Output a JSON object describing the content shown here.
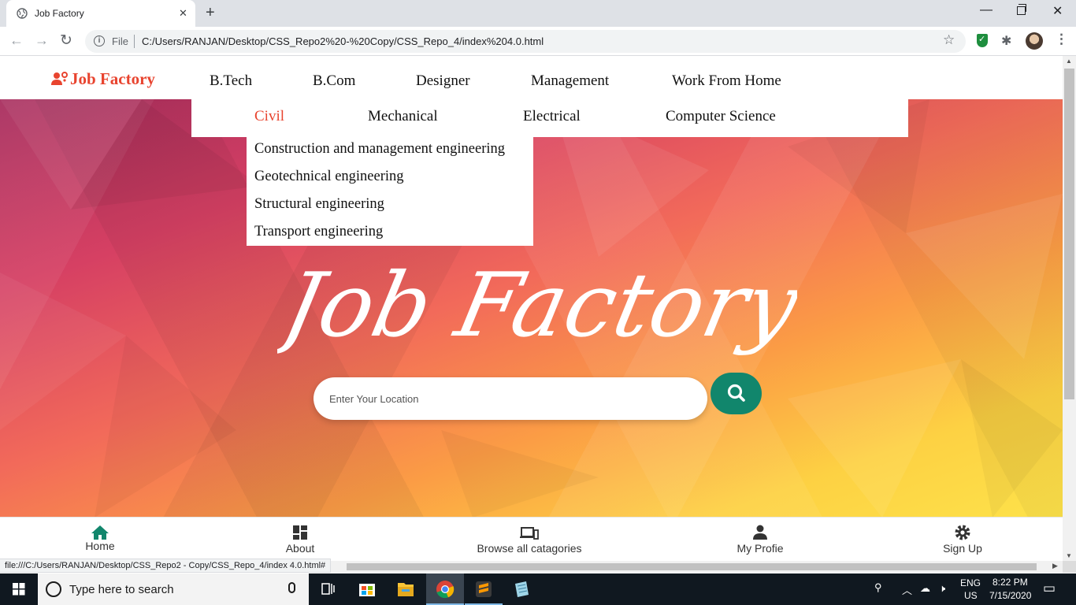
{
  "browser": {
    "tab_title": "Job Factory",
    "new_tab_symbol": "+",
    "scheme": "File",
    "url": "C:/Users/RANJAN/Desktop/CSS_Repo2%20-%20Copy/CSS_Repo_4/index%204.0.html",
    "status_url": "file:///C:/Users/RANJAN/Desktop/CSS_Repo2 - Copy/CSS_Repo_4/index 4.0.html#"
  },
  "site": {
    "logo_text": "Job Factory",
    "accent_color": "#e8442f",
    "nav_items": [
      "B.Tech",
      "B.Com",
      "Designer",
      "Management",
      "Work From Home"
    ],
    "submenu_items": [
      "Civil",
      "Mechanical",
      "Electrical",
      "Computer Science"
    ],
    "active_submenu": "Civil",
    "dropdown_items": [
      "Construction and management engineering",
      "Geotechnical engineering",
      "Structural engineering",
      "Transport engineering"
    ],
    "hero_title": "Job Factory",
    "search_placeholder": "Enter Your Location",
    "search_button_color": "#11866c",
    "bottom_nav": [
      {
        "label": "Home",
        "icon": "home-icon"
      },
      {
        "label": "About",
        "icon": "dashboard-icon"
      },
      {
        "label": "Browse all catagories",
        "icon": "devices-icon"
      },
      {
        "label": "My Profie",
        "icon": "person-icon"
      },
      {
        "label": "Sign Up",
        "icon": "gear-icon"
      }
    ]
  },
  "taskbar": {
    "search_placeholder": "Type here to search",
    "language": "ENG",
    "region": "US",
    "time": "8:22 PM",
    "date": "7/15/2020"
  }
}
